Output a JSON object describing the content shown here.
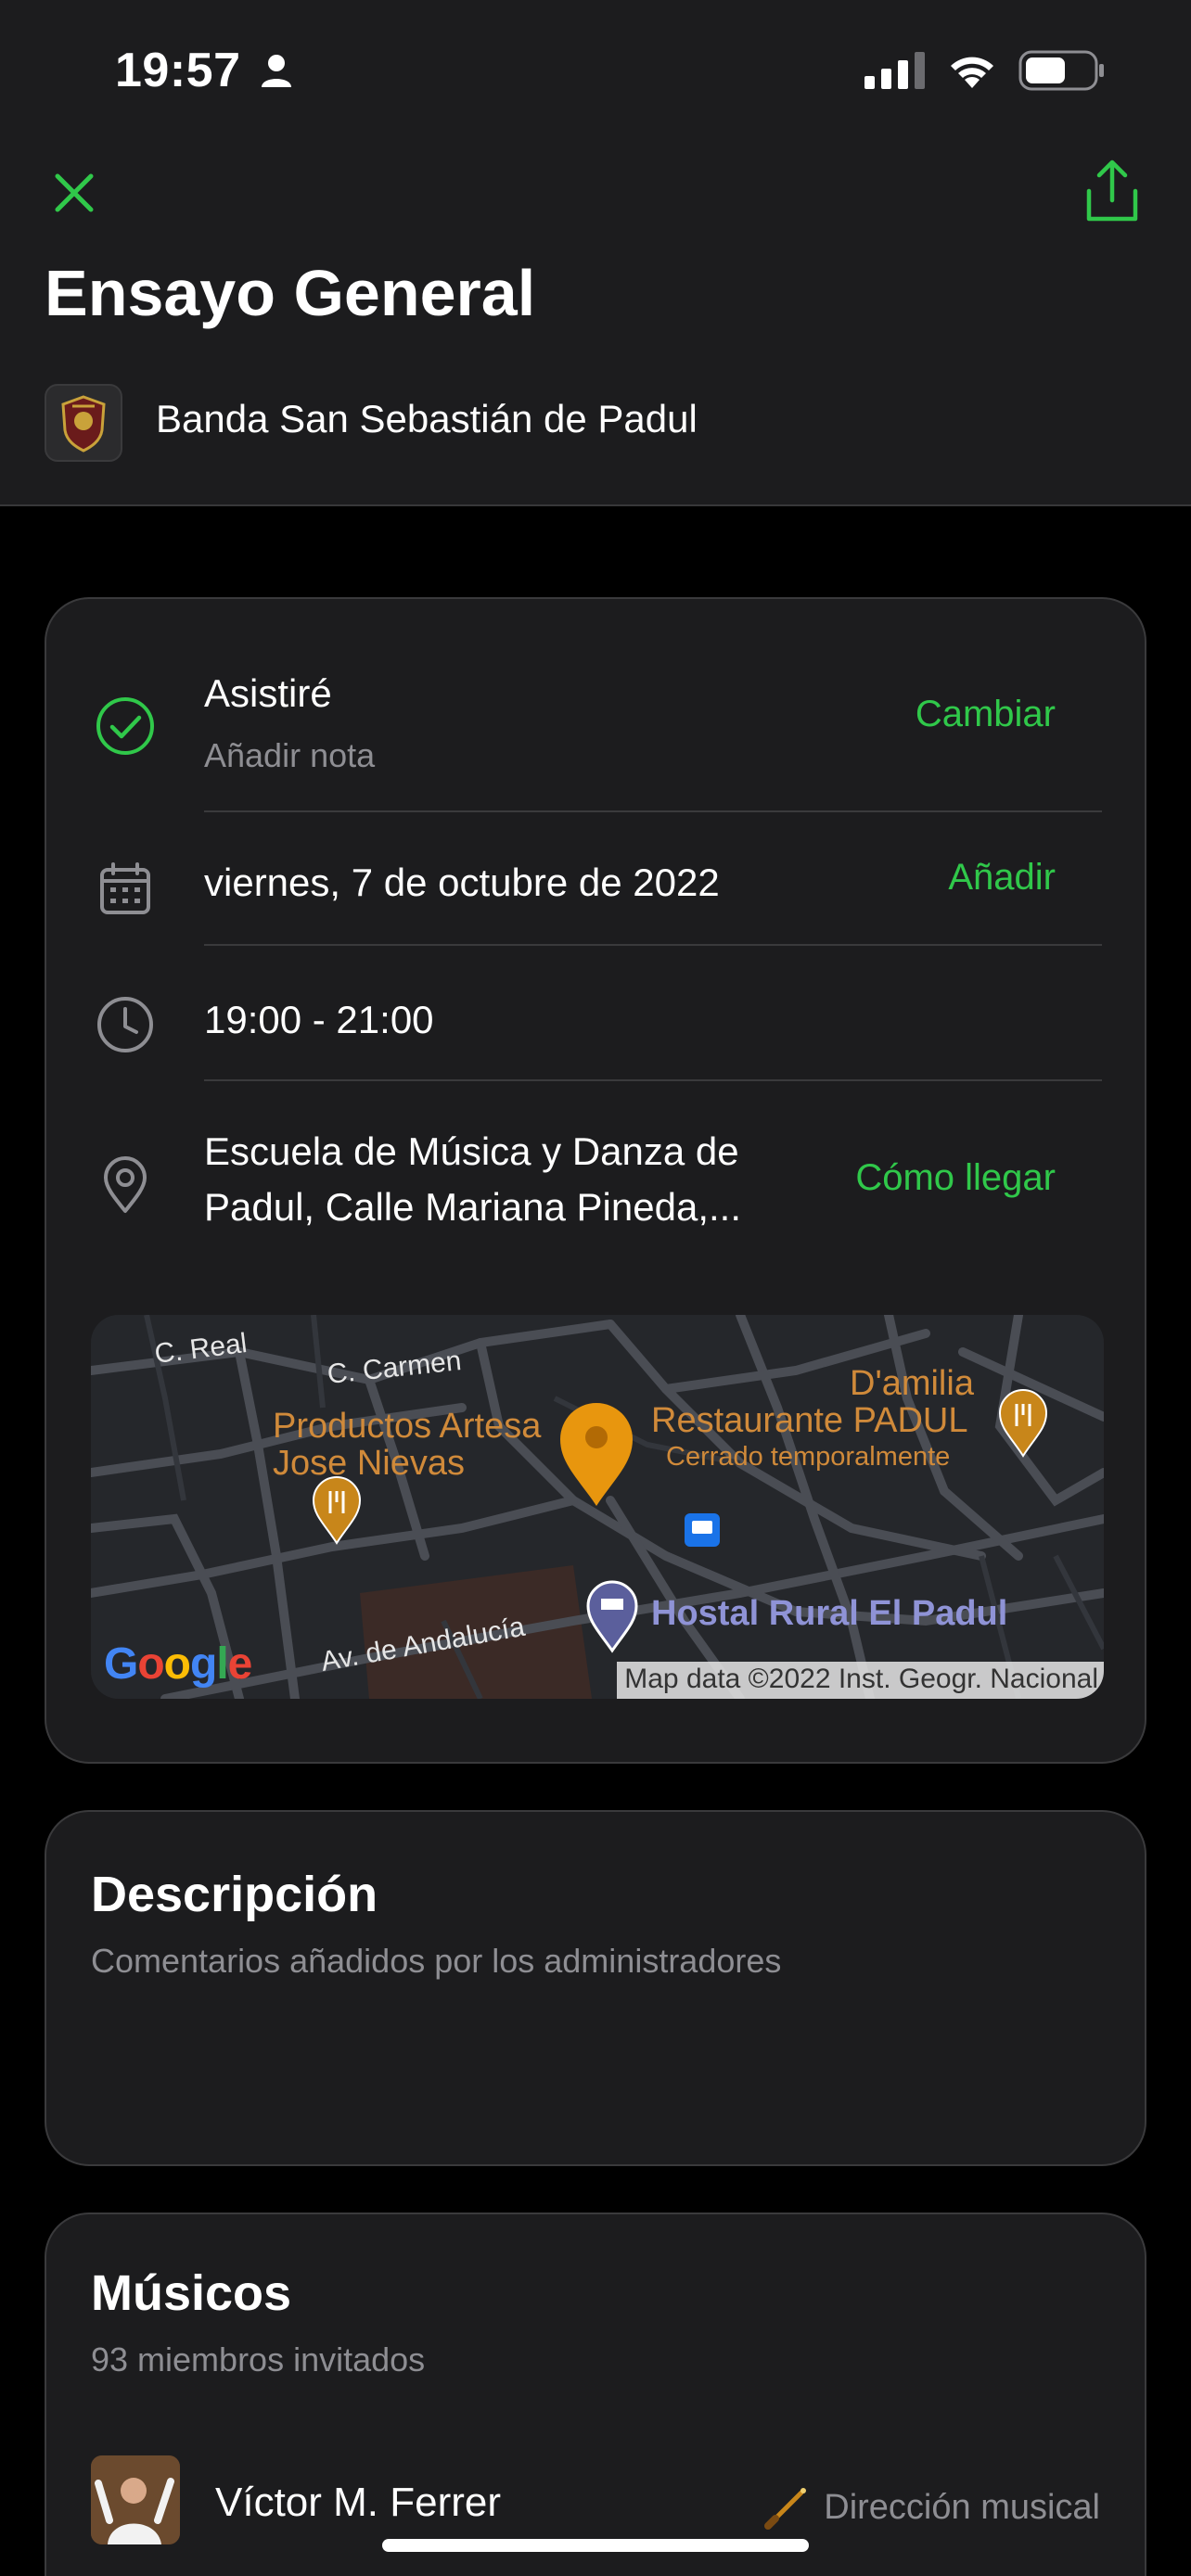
{
  "status_bar": {
    "time": "19:57"
  },
  "header": {
    "title": "Ensayo General",
    "organization": "Banda San Sebastián de Padul"
  },
  "event": {
    "attendance": {
      "status": "Asistiré",
      "note_placeholder": "Añadir nota",
      "action": "Cambiar"
    },
    "date": {
      "text": "viernes, 7 de octubre de 2022",
      "action": "Añadir"
    },
    "time": {
      "text": "19:00 - 21:00"
    },
    "location": {
      "line1": "Escuela de Música y Danza de",
      "line2": "Padul, Calle Mariana Pineda,...",
      "action": "Cómo llegar"
    },
    "map": {
      "labels": {
        "street1": "C. Real",
        "street2": "C. Carmen",
        "street3": "Av. de Andalucía",
        "poi1_line1": "Productos Artesa",
        "poi1_line2": "Jose Nievas",
        "poi2": "Restaurante PADUL",
        "poi2_status": "Cerrado temporalmente",
        "poi3": "D'amilia",
        "poi4": "Hostal Rural El Padul"
      },
      "attribution": "Map data ©2022 Inst. Geogr. Nacional",
      "logo": "Google"
    }
  },
  "description": {
    "title": "Descripción",
    "subtitle": "Comentarios añadidos por los administradores"
  },
  "musicians": {
    "title": "Músicos",
    "subtitle": "93 miembros invitados",
    "members": [
      {
        "name": "Víctor M. Ferrer",
        "role": "Dirección musical"
      }
    ]
  },
  "colors": {
    "accent": "#30c84a",
    "secondary_text": "#8e8e93",
    "card_bg": "#1c1c1e"
  }
}
